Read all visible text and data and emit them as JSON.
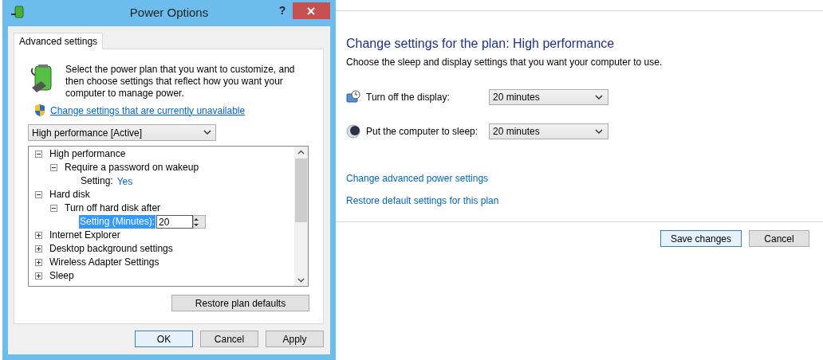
{
  "dialog": {
    "title": "Power Options",
    "help_button": "?",
    "tabs": [
      {
        "label": "Advanced settings",
        "selected": true
      }
    ],
    "intro": "Select the power plan that you want to customize, and then choose settings that reflect how you want your computer to manage power.",
    "admin_link": "Change settings that are currently unavailable",
    "plan_select": {
      "value": "High performance [Active]"
    },
    "plan_tree": [
      {
        "label": "High performance",
        "expanded": true,
        "selected": false,
        "children": [
          {
            "label": "Require a password on wakeup",
            "expanded": true,
            "selected": false,
            "children": [
              {
                "kind": "setting",
                "label": "Setting:",
                "value": "Yes",
                "selected": false
              }
            ]
          }
        ]
      },
      {
        "label": "Hard disk",
        "expanded": true,
        "selected": false,
        "children": [
          {
            "label": "Turn off hard disk after",
            "expanded": true,
            "selected": false,
            "children": [
              {
                "kind": "spinner",
                "label": "Setting (Minutes):",
                "value": "20",
                "selected": true
              }
            ]
          }
        ]
      },
      {
        "label": "Internet Explorer",
        "expanded": false,
        "selected": false
      },
      {
        "label": "Desktop background settings",
        "expanded": false,
        "selected": false
      },
      {
        "label": "Wireless Adapter Settings",
        "expanded": false,
        "selected": false
      },
      {
        "label": "Sleep",
        "expanded": false,
        "selected": false
      }
    ],
    "restore_button": "Restore plan defaults",
    "buttons": [
      {
        "label": "OK",
        "default": true
      },
      {
        "label": "Cancel",
        "default": false
      },
      {
        "label": "Apply",
        "default": false
      }
    ]
  },
  "page": {
    "heading": "Change settings for the plan: High performance",
    "description": "Choose the sleep and display settings that you want your computer to use.",
    "settings": [
      {
        "kind": "display",
        "label": "Turn off the display:",
        "value": "20 minutes"
      },
      {
        "kind": "sleep",
        "label": "Put the computer to sleep:",
        "value": "20 minutes"
      }
    ],
    "links": [
      "Change advanced power settings",
      "Restore default settings for this plan"
    ],
    "buttons": [
      {
        "label": "Save changes",
        "default": true
      },
      {
        "label": "Cancel",
        "default": false
      }
    ]
  }
}
